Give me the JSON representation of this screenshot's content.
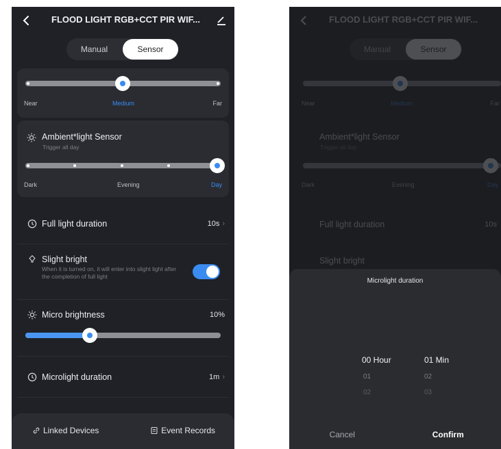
{
  "header": {
    "title": "FLOOD LIGHT RGB+CCT PIR WIF..."
  },
  "mode_tabs": [
    {
      "label": "Manual"
    },
    {
      "label": "Sensor"
    }
  ],
  "mode_selected": "Sensor",
  "distance": {
    "labels": [
      "Near",
      "Medium",
      "Far"
    ],
    "selected": "Medium"
  },
  "ambient": {
    "title": "Ambient*light Sensor",
    "subtitle": "Trigger all day",
    "labels": [
      "Dark",
      "Evening",
      "Day"
    ],
    "selected": "Day"
  },
  "full_light": {
    "title": "Full light duration",
    "value": "10s"
  },
  "slight_bright": {
    "title": "Slight bright",
    "description": "When it is turned on, it will enter into slight light after the completion of full light",
    "enabled": true
  },
  "micro_brightness": {
    "title": "Micro brightness",
    "value": "10%",
    "level_percent": 33
  },
  "microlight": {
    "title": "Microlight duration",
    "value": "1m"
  },
  "footer": {
    "linked": "Linked Devices",
    "events": "Event Records"
  },
  "picker": {
    "title": "Microlight duration",
    "hour_selected": "00 Hour",
    "min_selected": "01 Min",
    "hours_below": [
      "01",
      "02"
    ],
    "mins_below": [
      "02",
      "03"
    ],
    "cancel": "Cancel",
    "confirm": "Confirm"
  },
  "colors": {
    "accent": "#3a8cf0",
    "background": "#1f2126",
    "card": "#2a2c32"
  }
}
